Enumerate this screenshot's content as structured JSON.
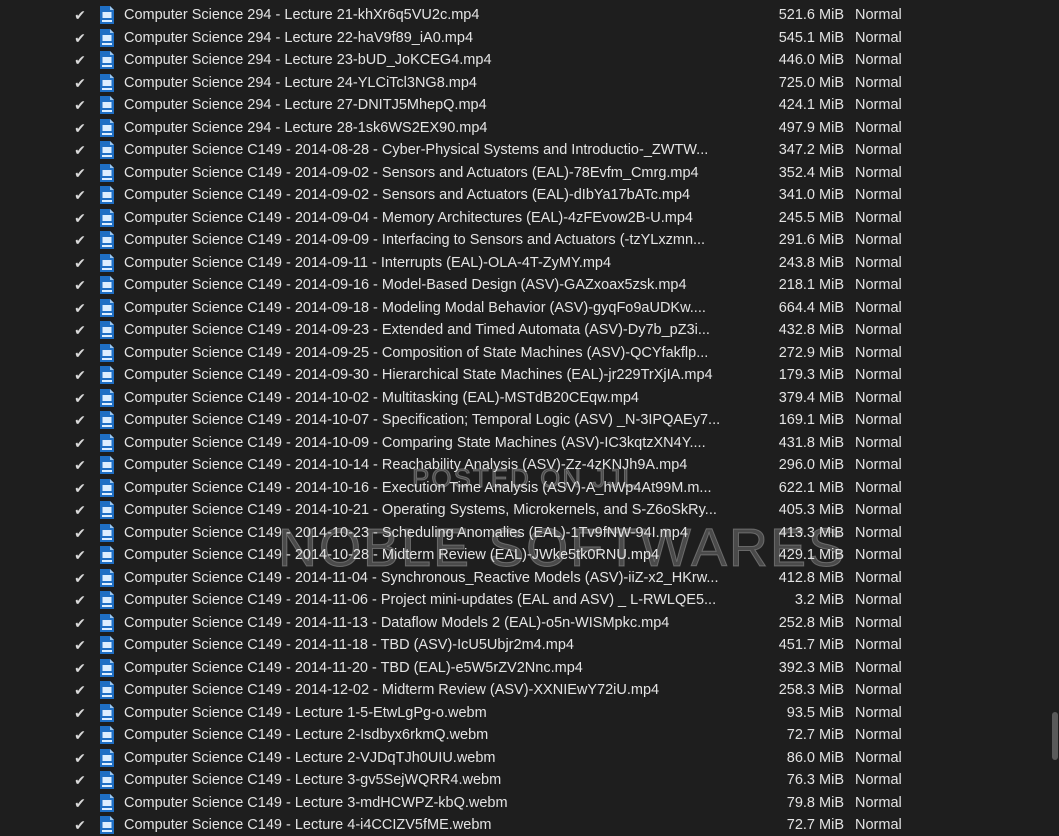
{
  "icons": {
    "check": "check-icon",
    "file": "video-file-icon"
  },
  "colors": {
    "background": "#1e1e1e",
    "text": "#e4e4e4",
    "icon_blue": "#1f6fc4"
  },
  "watermark": {
    "line1": "POSTED ON JJL",
    "line2": "NOBLE SOFTWARES"
  },
  "files": [
    {
      "checked": true,
      "name": "Computer Science 294 - Lecture 21-khXr6q5VU2c.mp4",
      "size": "521.6 MiB",
      "priority": "Normal"
    },
    {
      "checked": true,
      "name": "Computer Science 294 - Lecture 22-haV9f89_iA0.mp4",
      "size": "545.1 MiB",
      "priority": "Normal"
    },
    {
      "checked": true,
      "name": "Computer Science 294 - Lecture 23-bUD_JoKCEG4.mp4",
      "size": "446.0 MiB",
      "priority": "Normal"
    },
    {
      "checked": true,
      "name": "Computer Science 294 - Lecture 24-YLCiTcl3NG8.mp4",
      "size": "725.0 MiB",
      "priority": "Normal"
    },
    {
      "checked": true,
      "name": "Computer Science 294 - Lecture 27-DNITJ5MhepQ.mp4",
      "size": "424.1 MiB",
      "priority": "Normal"
    },
    {
      "checked": true,
      "name": "Computer Science 294 - Lecture 28-1sk6WS2EX90.mp4",
      "size": "497.9 MiB",
      "priority": "Normal"
    },
    {
      "checked": true,
      "name": "Computer Science C149 - 2014-08-28 - Cyber-Physical Systems and Introductio-_ZWTW...",
      "size": "347.2 MiB",
      "priority": "Normal"
    },
    {
      "checked": true,
      "name": "Computer Science C149 - 2014-09-02 - Sensors and Actuators (EAL)-78Evfm_Cmrg.mp4",
      "size": "352.4 MiB",
      "priority": "Normal"
    },
    {
      "checked": true,
      "name": "Computer Science C149 - 2014-09-02 - Sensors and Actuators (EAL)-dIbYa17bATc.mp4",
      "size": "341.0 MiB",
      "priority": "Normal"
    },
    {
      "checked": true,
      "name": "Computer Science C149 - 2014-09-04 - Memory Architectures (EAL)-4zFEvow2B-U.mp4",
      "size": "245.5 MiB",
      "priority": "Normal"
    },
    {
      "checked": true,
      "name": "Computer Science C149 - 2014-09-09 - Interfacing to Sensors and Actuators (-tzYLxzmn...",
      "size": "291.6 MiB",
      "priority": "Normal"
    },
    {
      "checked": true,
      "name": "Computer Science C149 - 2014-09-11 - Interrupts (EAL)-OLA-4T-ZyMY.mp4",
      "size": "243.8 MiB",
      "priority": "Normal"
    },
    {
      "checked": true,
      "name": "Computer Science C149 - 2014-09-16 - Model-Based Design (ASV)-GAZxoax5zsk.mp4",
      "size": "218.1 MiB",
      "priority": "Normal"
    },
    {
      "checked": true,
      "name": "Computer Science C149 - 2014-09-18 - Modeling Modal Behavior (ASV)-gyqFo9aUDKw....",
      "size": "664.4 MiB",
      "priority": "Normal"
    },
    {
      "checked": true,
      "name": "Computer Science C149 - 2014-09-23 - Extended and Timed Automata (ASV)-Dy7b_pZ3i...",
      "size": "432.8 MiB",
      "priority": "Normal"
    },
    {
      "checked": true,
      "name": "Computer Science C149 - 2014-09-25 - Composition of State Machines (ASV)-QCYfakflp...",
      "size": "272.9 MiB",
      "priority": "Normal"
    },
    {
      "checked": true,
      "name": "Computer Science C149 - 2014-09-30 - Hierarchical State Machines (EAL)-jr229TrXjIA.mp4",
      "size": "179.3 MiB",
      "priority": "Normal"
    },
    {
      "checked": true,
      "name": "Computer Science C149 - 2014-10-02 - Multitasking (EAL)-MSTdB20CEqw.mp4",
      "size": "379.4 MiB",
      "priority": "Normal"
    },
    {
      "checked": true,
      "name": "Computer Science C149 - 2014-10-07 - Specification; Temporal Logic (ASV) _N-3IPQAEy7...",
      "size": "169.1 MiB",
      "priority": "Normal"
    },
    {
      "checked": true,
      "name": "Computer Science C149 - 2014-10-09 - Comparing State Machines (ASV)-IC3kqtzXN4Y....",
      "size": "431.8 MiB",
      "priority": "Normal"
    },
    {
      "checked": true,
      "name": "Computer Science C149 - 2014-10-14 - Reachability Analysis (ASV)-Zz-4zKNJh9A.mp4",
      "size": "296.0 MiB",
      "priority": "Normal"
    },
    {
      "checked": true,
      "name": "Computer Science C149 - 2014-10-16 - Execution Time Analysis (ASV)-A_hWp4At99M.m...",
      "size": "622.1 MiB",
      "priority": "Normal"
    },
    {
      "checked": true,
      "name": "Computer Science C149 - 2014-10-21 - Operating Systems, Microkernels, and S-Z6oSkRy...",
      "size": "405.3 MiB",
      "priority": "Normal"
    },
    {
      "checked": true,
      "name": "Computer Science C149 - 2014-10-23 - Scheduling Anomalies (EAL)-1Tv9fNW-94I.mp4",
      "size": "413.3 MiB",
      "priority": "Normal"
    },
    {
      "checked": true,
      "name": "Computer Science C149 - 2014-10-28 - Midterm Review (EAL)-JWke5tk0RNU.mp4",
      "size": "429.1 MiB",
      "priority": "Normal"
    },
    {
      "checked": true,
      "name": "Computer Science C149 - 2014-11-04 - Synchronous_Reactive Models (ASV)-iiZ-x2_HKrw...",
      "size": "412.8 MiB",
      "priority": "Normal"
    },
    {
      "checked": true,
      "name": "Computer Science C149 - 2014-11-06 - Project mini-updates (EAL and ASV) _ L-RWLQE5...",
      "size": "3.2 MiB",
      "priority": "Normal"
    },
    {
      "checked": true,
      "name": "Computer Science C149 - 2014-11-13 - Dataflow Models 2 (EAL)-o5n-WISMpkc.mp4",
      "size": "252.8 MiB",
      "priority": "Normal"
    },
    {
      "checked": true,
      "name": "Computer Science C149 - 2014-11-18 - TBD (ASV)-IcU5Ubjr2m4.mp4",
      "size": "451.7 MiB",
      "priority": "Normal"
    },
    {
      "checked": true,
      "name": "Computer Science C149 - 2014-11-20 - TBD  (EAL)-e5W5rZV2Nnc.mp4",
      "size": "392.3 MiB",
      "priority": "Normal"
    },
    {
      "checked": true,
      "name": "Computer Science C149 - 2014-12-02 - Midterm Review (ASV)-XXNIEwY72iU.mp4",
      "size": "258.3 MiB",
      "priority": "Normal"
    },
    {
      "checked": true,
      "name": "Computer Science C149 - Lecture 1-5-EtwLgPg-o.webm",
      "size": "93.5 MiB",
      "priority": "Normal"
    },
    {
      "checked": true,
      "name": "Computer Science C149 - Lecture 2-Isdbyx6rkmQ.webm",
      "size": "72.7 MiB",
      "priority": "Normal"
    },
    {
      "checked": true,
      "name": "Computer Science C149 - Lecture 2-VJDqTJh0UIU.webm",
      "size": "86.0 MiB",
      "priority": "Normal"
    },
    {
      "checked": true,
      "name": "Computer Science C149 - Lecture 3-gv5SejWQRR4.webm",
      "size": "76.3 MiB",
      "priority": "Normal"
    },
    {
      "checked": true,
      "name": "Computer Science C149 - Lecture 3-mdHCWPZ-kbQ.webm",
      "size": "79.8 MiB",
      "priority": "Normal"
    },
    {
      "checked": true,
      "name": "Computer Science C149 - Lecture 4-i4CCIZV5fME.webm",
      "size": "72.7 MiB",
      "priority": "Normal"
    }
  ]
}
